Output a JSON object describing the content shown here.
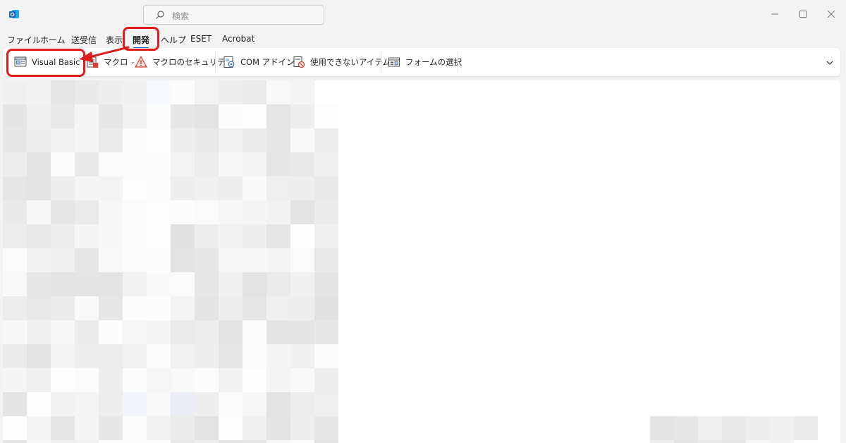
{
  "titlebar": {
    "search_placeholder": "検索"
  },
  "menu": {
    "tabs": [
      {
        "label": "ファイル"
      },
      {
        "label": "ホーム"
      },
      {
        "label": "送受信"
      },
      {
        "label": "表示"
      },
      {
        "label": "開発"
      },
      {
        "label": "ヘルプ"
      },
      {
        "label": "ESET"
      },
      {
        "label": "Acrobat"
      }
    ],
    "active_tab": "開発"
  },
  "ribbon": {
    "visual_basic": "Visual Basic",
    "macro": "マクロ",
    "macro_security": "マクロのセキュリティ",
    "com_addin": "COM アドイン",
    "disabled_items": "使用できないアイテム",
    "choose_form": "フォームの選択"
  },
  "colors": {
    "highlight": "#e01b1b",
    "accent": "#0f6cbd",
    "app_blue": "#0a64c8"
  }
}
